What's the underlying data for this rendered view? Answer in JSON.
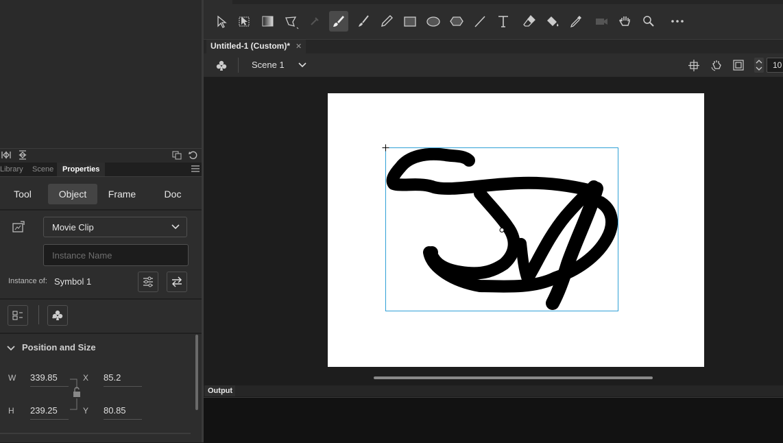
{
  "panel_tabs": [
    "Library",
    "Scene",
    "Properties"
  ],
  "subtabs": [
    "Tool",
    "Object",
    "Frame",
    "Doc"
  ],
  "symbol_type": "Movie Clip",
  "instance_name_placeholder": "Instance Name",
  "instance_of": {
    "label": "Instance of:",
    "value": "Symbol 1"
  },
  "position_size": {
    "title": "Position and Size",
    "w_label": "W",
    "w": "339.85",
    "h_label": "H",
    "h": "239.25",
    "x_label": "X",
    "x": "85.2",
    "y_label": "Y",
    "y": "80.85"
  },
  "document_tab": "Untitled-1 (Custom)*",
  "scene": "Scene 1",
  "zoom": "10",
  "output_label": "Output",
  "colors": {
    "accent_selection": "#2e9fd6",
    "panel_bg": "#2d2d2d",
    "stage_bg": "#ffffff"
  },
  "icons": [
    "selection-icon",
    "free-transform-icon",
    "gradient-icon",
    "lasso-icon",
    "bone-icon",
    "brush-icon",
    "paint-brush-icon",
    "pencil-icon",
    "rectangle-icon",
    "oval-icon",
    "polystar-icon",
    "line-icon",
    "text-icon",
    "eraser-icon",
    "paint-bucket-icon",
    "eyedropper-icon",
    "camera-icon",
    "hand-icon",
    "zoom-icon",
    "more-icon"
  ]
}
